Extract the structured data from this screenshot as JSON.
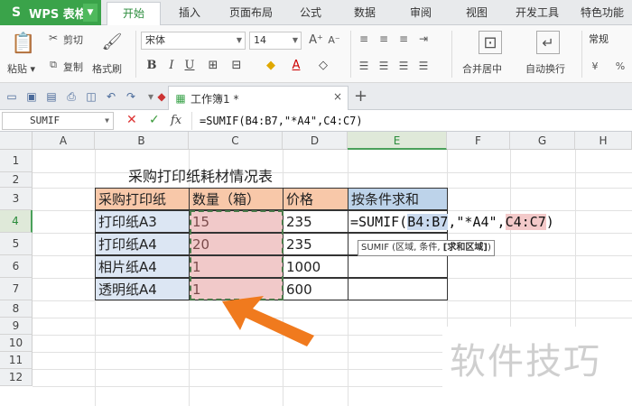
{
  "menubar": {
    "logo": "WPS 表格",
    "tabs": [
      "开始",
      "插入",
      "页面布局",
      "公式",
      "数据",
      "审阅",
      "视图",
      "开发工具",
      "特色功能"
    ]
  },
  "ribbon": {
    "paste": "粘贴",
    "cut": "剪切",
    "copy": "复制",
    "format_painter": "格式刷",
    "font_name": "宋体",
    "font_size": "14",
    "merge_center": "合并居中",
    "wrap_text": "自动换行",
    "number_format": "常规",
    "bold": "B",
    "italic": "I",
    "underline": "U",
    "font_color": "A"
  },
  "doc_tab": {
    "label": "工作簿1 *",
    "close": "×",
    "add": "+"
  },
  "formula_bar": {
    "name_box": "SUMIF",
    "fx": "fx",
    "cancel": "✕",
    "confirm": "✓",
    "formula": "=SUMIF(B4:B7,\"*A4\",C4:C7)"
  },
  "grid": {
    "columns": [
      "A",
      "B",
      "C",
      "D",
      "E",
      "F",
      "G",
      "H"
    ],
    "rows": [
      "1",
      "2",
      "3",
      "4",
      "5",
      "6",
      "7",
      "8",
      "9",
      "10",
      "11",
      "12"
    ],
    "selected_column": "E",
    "selected_row": "4"
  },
  "sheet": {
    "title": "采购打印纸耗材情况表",
    "headers": [
      "采购打印纸",
      "数量（箱）",
      "价格",
      "按条件求和"
    ],
    "rows": [
      {
        "item": "打印纸A3",
        "qty": "15",
        "price": "235"
      },
      {
        "item": "打印纸A4",
        "qty": "20",
        "price": "235"
      },
      {
        "item": "相片纸A4",
        "qty": "1",
        "price": "1000"
      },
      {
        "item": "透明纸A4",
        "qty": "1",
        "price": "600"
      }
    ],
    "edit_formula": {
      "prefix": "=SUMIF(",
      "arg1": "B4:B7",
      "mid": ",\"*A4\",",
      "arg3": "C4:C7",
      "suffix": ")"
    },
    "tooltip_prefix": "SUMIF (区域, 条件, ",
    "tooltip_bold": "[求和区域]",
    "tooltip_suffix": ")"
  },
  "watermark": "软件技巧",
  "colors": {
    "brand_green": "#3aa34a",
    "header_orange": "#f8c8a9",
    "item_blue": "#dce6f3",
    "qty_pink": "#f1c9c9",
    "arrow_orange": "#f07a1e"
  }
}
